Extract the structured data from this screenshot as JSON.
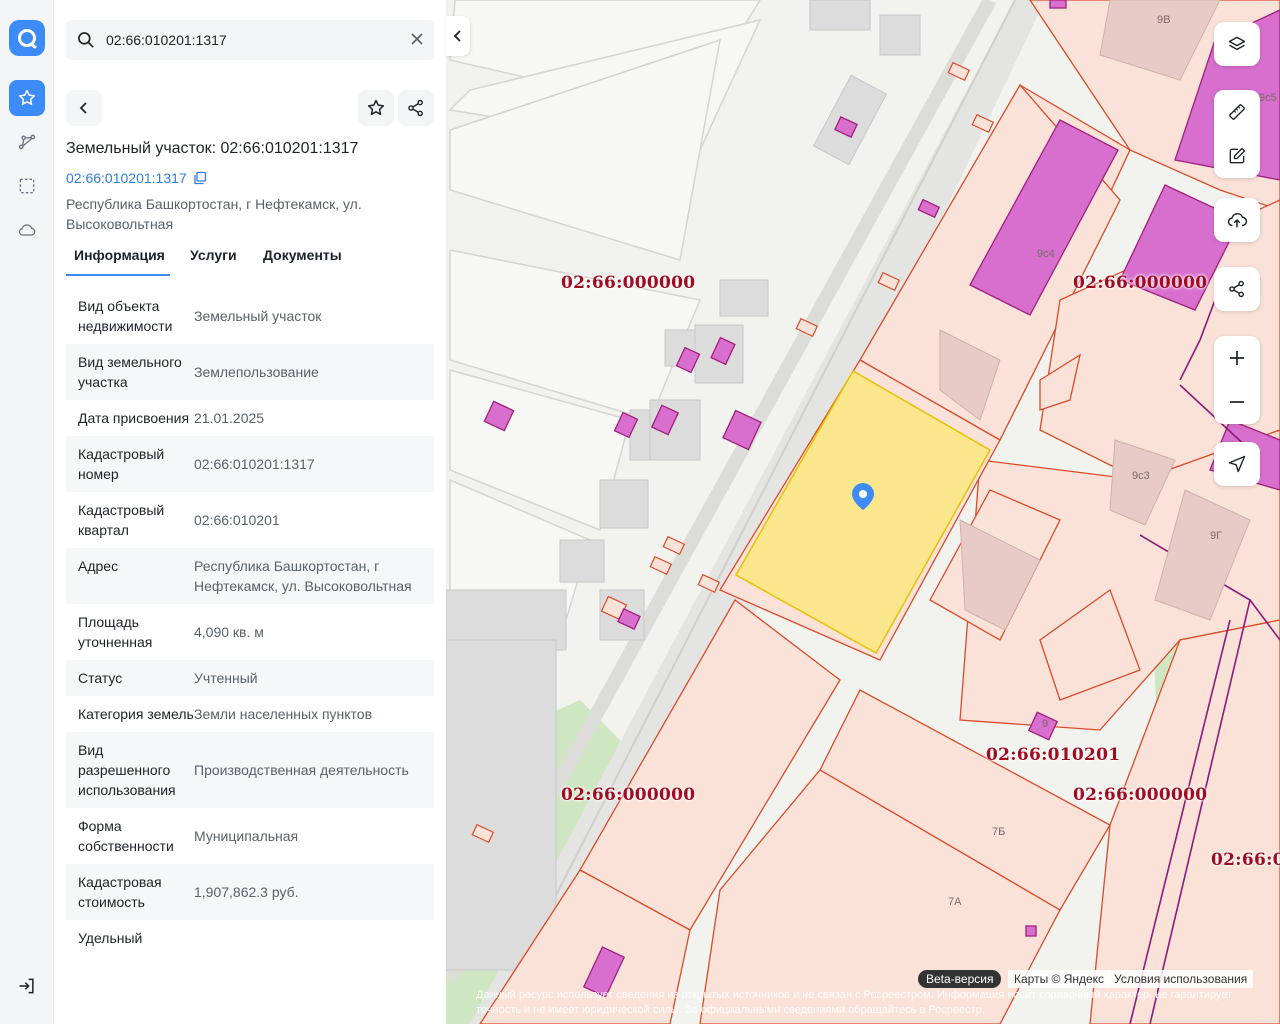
{
  "search": {
    "value": "02:66:010201:1317",
    "placeholder": ""
  },
  "object": {
    "title": "Земельный участок: 02:66:010201:1317",
    "cad_number": "02:66:010201:1317",
    "address": "Республика Башкортостан, г Нефтекамск, ул. Высоковольтная"
  },
  "tabs": [
    {
      "label": "Информация"
    },
    {
      "label": "Услуги"
    },
    {
      "label": "Документы"
    }
  ],
  "info": [
    {
      "k": "Вид объекта недвижимости",
      "v": "Земельный участок"
    },
    {
      "k": "Вид земельного участка",
      "v": "Землепользование"
    },
    {
      "k": "Дата присвоения",
      "v": "21.01.2025"
    },
    {
      "k": "Кадастровый номер",
      "v": "02:66:010201:1317"
    },
    {
      "k": "Кадастровый квартал",
      "v": "02:66:010201"
    },
    {
      "k": "Адрес",
      "v": "Республика Башкортостан, г Нефтекамск, ул. Высоковольтная"
    },
    {
      "k": "Площадь уточненная",
      "v": "4,090 кв. м"
    },
    {
      "k": "Статус",
      "v": "Учтенный"
    },
    {
      "k": "Категория земель",
      "v": "Земли населенных пунктов"
    },
    {
      "k": "Вид разрешенного использования",
      "v": "Производственная деятельность"
    },
    {
      "k": "Форма собственности",
      "v": "Муниципальная"
    },
    {
      "k": "Кадастровая стоимость",
      "v": "1,907,862.3 руб."
    },
    {
      "k": "Удельный",
      "v": ""
    }
  ],
  "map": {
    "labels": {
      "q1": "02:66:000000",
      "q2": "02:66:000000",
      "q3": "02:66:000000",
      "q4": "02:66:010201",
      "q5": "02:66:000000",
      "q6": "02:66:0"
    },
    "building_numbers": {
      "b9v": "9В",
      "b9s5": "9с5",
      "b9s4": "9с4",
      "b9s3": "9с3",
      "b9g": "9Г",
      "b9": "9",
      "b7b": "7Б",
      "b7a": "7А"
    },
    "attribution": {
      "beta": "Beta-версия",
      "copyright": "Карты © Яндекс",
      "terms": "Условия использования"
    },
    "disclaimer": "Данный ресурс использует сведения из открытых источников и не связан с Росреестром. Информация носит справочный характер, не гарантирует точность и не имеет юридической силы. За официальными сведениями обращайтесь в Росреестр."
  },
  "colors": {
    "accent": "#3d8bf6",
    "parcel_border": "#d94c2b",
    "parcel_fill": "#fbe2d8",
    "selected_fill": "#f8e680",
    "building_fill": "#d86fcf",
    "quarter_label": "#a00c22"
  }
}
